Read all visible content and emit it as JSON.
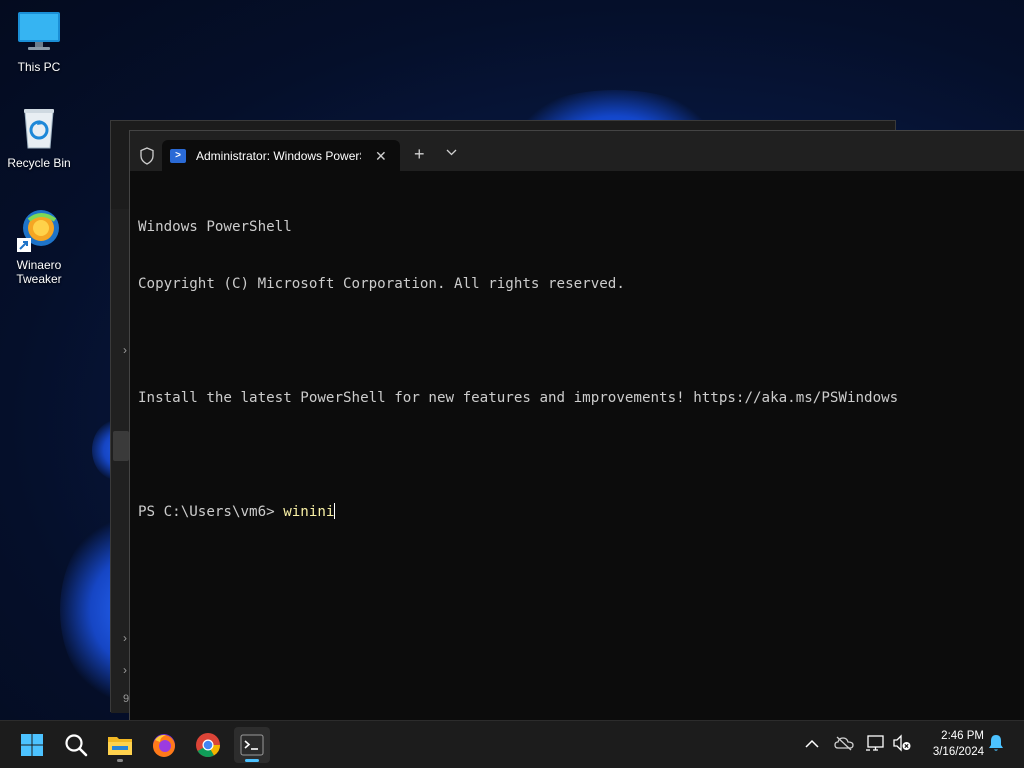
{
  "desktop": {
    "icons": [
      {
        "label": "This PC"
      },
      {
        "label": "Recycle Bin"
      },
      {
        "label": "Winaero\nTweaker"
      }
    ]
  },
  "terminal": {
    "tab_title": "Administrator: Windows PowerShell",
    "tab_icon": "powershell-icon",
    "lines": [
      "Windows PowerShell",
      "Copyright (C) Microsoft Corporation. All rights reserved.",
      "",
      "Install the latest PowerShell for new features and improvements! https://aka.ms/PSWindows",
      ""
    ],
    "prompt": "PS C:\\Users\\vm6> ",
    "command": "winini"
  },
  "taskbar": {
    "apps": [
      "start-icon",
      "search-icon",
      "file-explorer-icon",
      "firefox-icon",
      "chrome-icon",
      "terminal-icon"
    ],
    "tray_icons": [
      "chevron-up-icon",
      "onedrive-icon",
      "network-icon",
      "volume-muted-icon",
      "notification-bell-icon"
    ],
    "time": "2:46 PM",
    "date": "3/16/2024"
  },
  "background_window": {
    "stray_text": "9"
  },
  "colors": {
    "accent": "#4cc2ff",
    "console_bg": "#0c0c0c",
    "console_text": "#cccccc",
    "command_text": "#f9f1a5"
  }
}
